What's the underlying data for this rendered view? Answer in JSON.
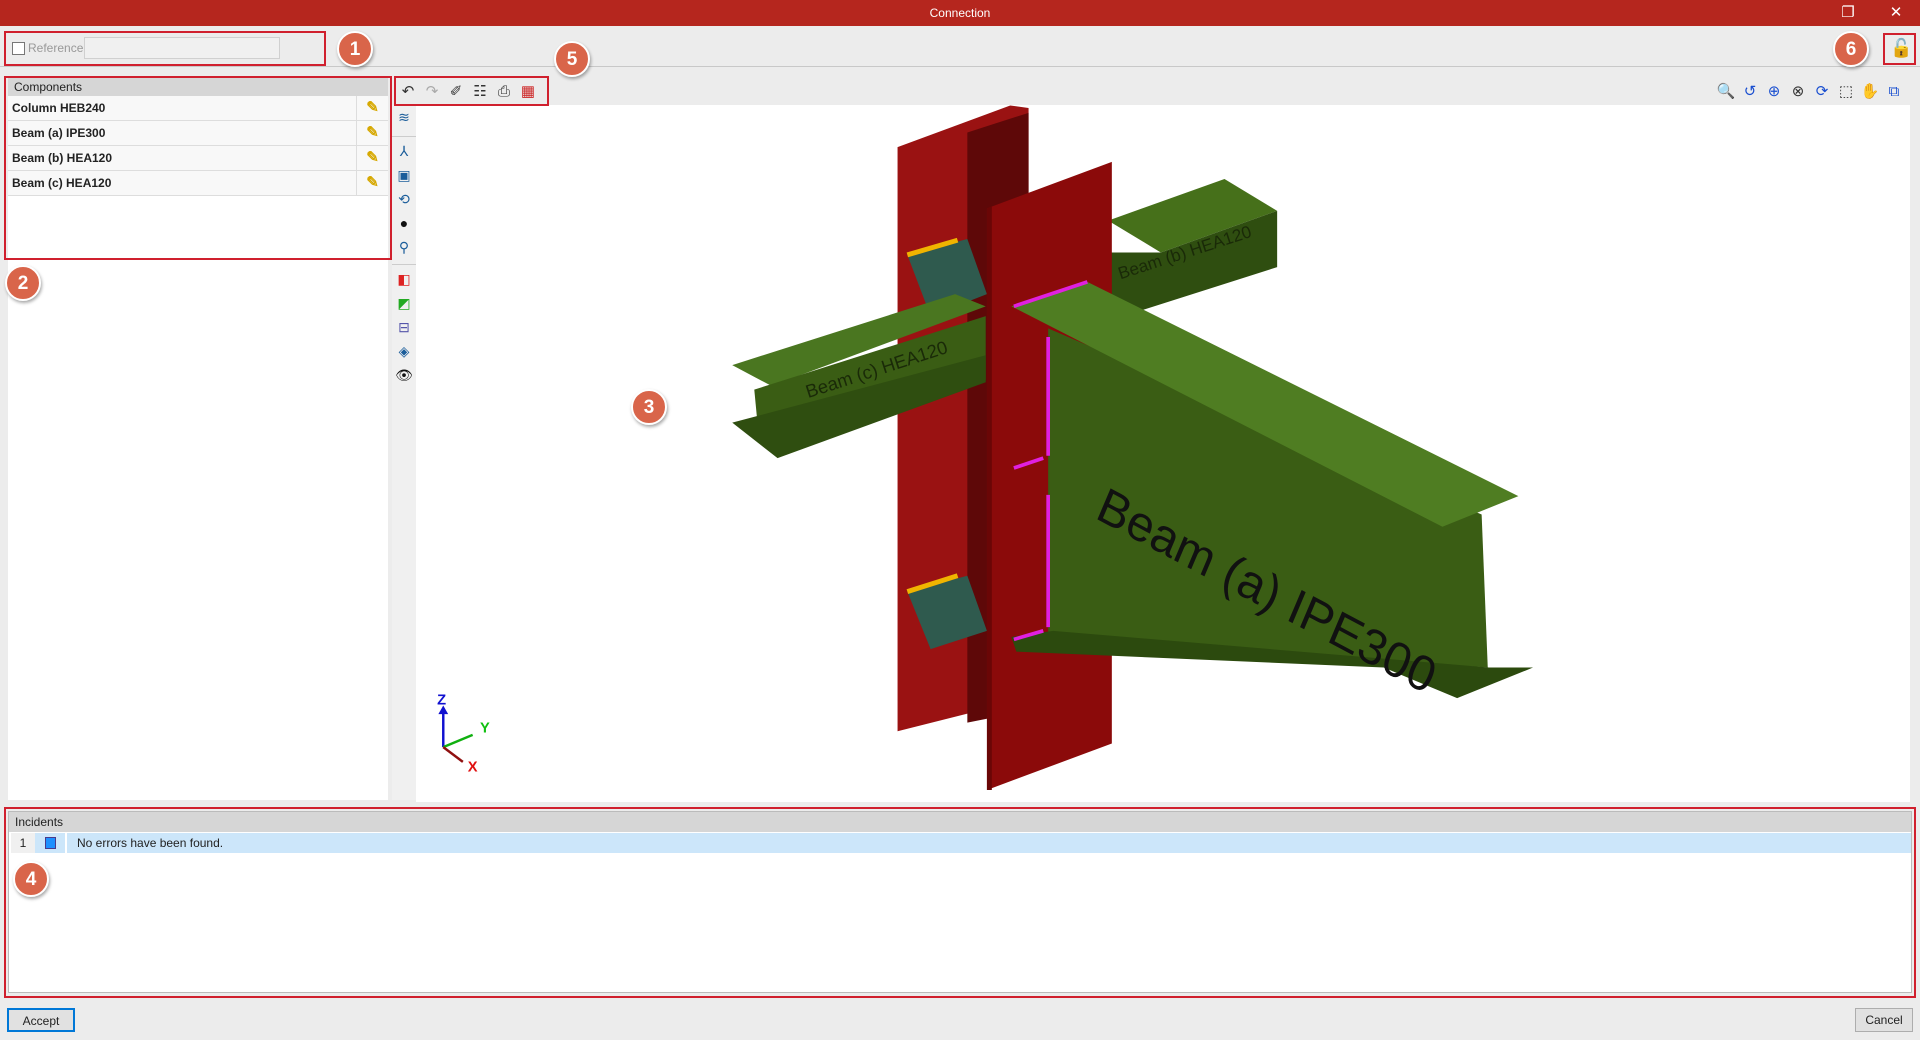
{
  "window": {
    "title": "Connection",
    "restore_icon": "restore-icon",
    "close_icon": "close-icon"
  },
  "reference": {
    "label": "Reference",
    "checked": false,
    "value": ""
  },
  "components": {
    "header": "Components",
    "items": [
      {
        "label": "Column HEB240",
        "icon": "pencil-icon"
      },
      {
        "label": "Beam (a) IPE300",
        "icon": "pencil-icon"
      },
      {
        "label": "Beam (b) HEA120",
        "icon": "pencil-icon"
      },
      {
        "label": "Beam (c) HEA120",
        "icon": "pencil-icon"
      }
    ]
  },
  "model": {
    "labels": {
      "beam_a": "Beam (a) IPE300",
      "beam_b": "Beam (b) HEA120",
      "beam_c": "Beam (c) HEA120"
    },
    "axes": {
      "z": "Z",
      "y": "Y",
      "x": "X"
    },
    "colors": {
      "column": "#8b0a0a",
      "beam": "#3b5e14",
      "plate": "#2f5a4e",
      "weld_yellow": "#f0b400",
      "weld_magenta": "#e020e0"
    }
  },
  "incidents": {
    "header": "Incidents",
    "rows": [
      {
        "num": "1",
        "message": "No errors have been found."
      }
    ]
  },
  "buttons": {
    "accept": "Accept",
    "cancel": "Cancel"
  },
  "callouts": [
    "1",
    "2",
    "3",
    "4",
    "5",
    "6"
  ],
  "accent": "#b5261e"
}
